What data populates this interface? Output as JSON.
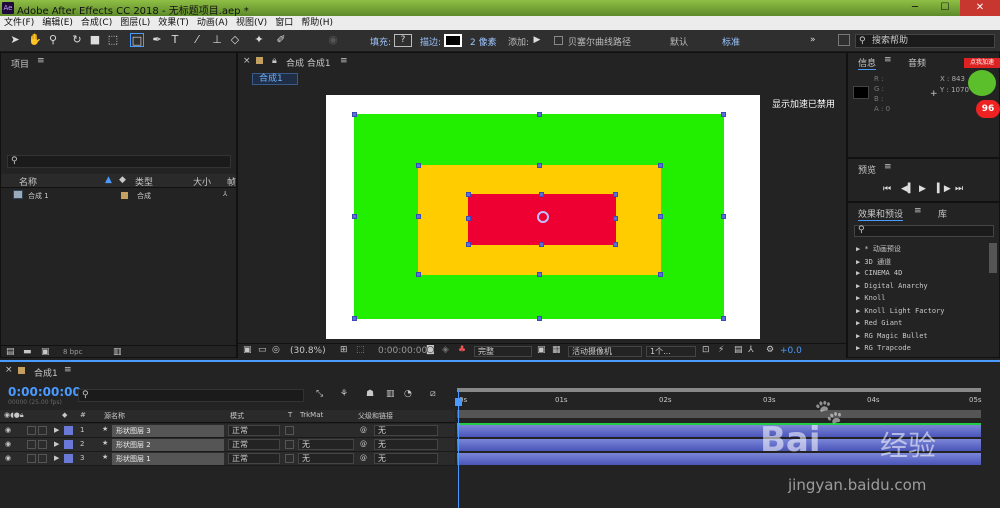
{
  "window": {
    "title": "Adobe After Effects CC 2018 - 无标题项目.aep *",
    "app_icon": "Ae",
    "minimize": "─",
    "maximize": "☐",
    "close": "✕"
  },
  "menu": [
    "文件(F)",
    "编辑(E)",
    "合成(C)",
    "图层(L)",
    "效果(T)",
    "动画(A)",
    "视图(V)",
    "窗口",
    "帮助(H)"
  ],
  "toolbar": {
    "fill_label": "填充:",
    "fill_value": "?",
    "stroke_label": "描边:",
    "stroke_width": "2 像素",
    "add_label": "添加:",
    "bezier_label": "贝塞尔曲线路径",
    "workspace_default": "默认",
    "workspace_standard": "标准",
    "search_placeholder": "搜索帮助",
    "more": "»"
  },
  "project": {
    "title": "项目",
    "search_placeholder": "",
    "columns": [
      "名称",
      "类型",
      "大小",
      "帧"
    ],
    "items": [
      {
        "name": "合成 1",
        "type": "合成"
      }
    ],
    "bpc": "8 bpc"
  },
  "composition": {
    "tab_title": "合成 合成1",
    "breadcrumb": "合成1",
    "gpu_notice": "显示加速已禁用",
    "zoom": "(30.8%)",
    "timecode": "0:00:00:00",
    "resolution": "完整",
    "camera": "活动摄像机",
    "views": "1个...",
    "exposure": "+0.0"
  },
  "info": {
    "tab_info": "信息",
    "tab_audio": "音频",
    "r": "R :",
    "g": "G :",
    "b": "B :",
    "a": "A : 0",
    "x": "X : 843",
    "y": "Y : 1070"
  },
  "preview": {
    "title": "预览"
  },
  "effects": {
    "tab": "效果和预设",
    "tab2": "库",
    "items": [
      "▶ * 动画预设",
      "▶ 3D 通道",
      "▶ CINEMA 4D",
      "▶ Digital Anarchy",
      "▶ Knoll",
      "▶ Knoll Light Factory",
      "▶ Red Giant",
      "▶ RG Magic Bullet",
      "▶ RG Trapcode"
    ]
  },
  "timeline": {
    "tab": "合成1",
    "timecode": "0:00:00:00",
    "fps": "00000 (25.00 fps)",
    "columns": {
      "num": "#",
      "name": "源名称",
      "mode": "模式",
      "t": "T",
      "trkmat": "TrkMat",
      "parent": "父级和链接"
    },
    "layers": [
      {
        "num": "1",
        "name": "形状图层 3",
        "mode": "正常",
        "trkmat": "",
        "parent": "无"
      },
      {
        "num": "2",
        "name": "形状图层 2",
        "mode": "正常",
        "trkmat": "无",
        "parent": "无"
      },
      {
        "num": "3",
        "name": "形状图层 1",
        "mode": "正常",
        "trkmat": "无",
        "parent": "无"
      }
    ],
    "ruler": [
      "0s",
      "01s",
      "02s",
      "03s",
      "04s",
      "05s"
    ]
  },
  "colors": {
    "green": "#22ee00",
    "orange": "#ffcc00",
    "red": "#ee0033",
    "accent": "#4a9bff"
  },
  "watermark": {
    "brand": "Bai",
    "brand2": "经验",
    "url": "jingyan.baidu.com",
    "badge": "96",
    "badge_label": "点我加速"
  }
}
